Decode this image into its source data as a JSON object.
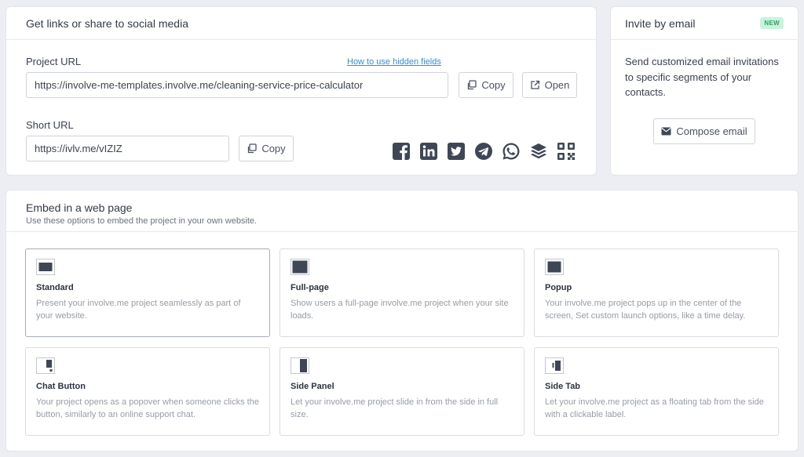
{
  "share": {
    "title": "Get links or share to social media",
    "project_url_label": "Project URL",
    "hidden_fields_link": "How to use hidden fields",
    "project_url_value": "https://involve-me-templates.involve.me/cleaning-service-price-calculator",
    "copy_label": "Copy",
    "open_label": "Open",
    "short_url_label": "Short URL",
    "short_url_value": "https://ivlv.me/vIZIZ",
    "social_icons": [
      "facebook-icon",
      "linkedin-icon",
      "twitter-icon",
      "telegram-icon",
      "whatsapp-icon",
      "buffer-icon",
      "qr-code-icon"
    ],
    "icon_color": "#3f4756"
  },
  "invite": {
    "title": "Invite by email",
    "badge": "NEW",
    "description": "Send customized email invitations to specific segments of your contacts.",
    "compose_label": "Compose email"
  },
  "embed": {
    "title": "Embed in a web page",
    "subtitle": "Use these options to embed the project in your own website.",
    "options": [
      {
        "icon": "standard-layout-icon",
        "title": "Standard",
        "description": "Present your involve.me project seamlessly as part of your website.",
        "selected": true
      },
      {
        "icon": "full-page-layout-icon",
        "title": "Full-page",
        "description": "Show users a full-page involve.me project when your site loads.",
        "selected": false
      },
      {
        "icon": "popup-layout-icon",
        "title": "Popup",
        "description": "Your involve.me project pops up in the center of the screen, Set custom launch options, like a time delay.",
        "selected": false
      },
      {
        "icon": "chat-button-layout-icon",
        "title": "Chat Button",
        "description": "Your project opens as a popover when someone clicks the button, similarly to an online support chat.",
        "selected": false
      },
      {
        "icon": "side-panel-layout-icon",
        "title": "Side Panel",
        "description": "Let your involve.me project slide in from the side in full size.",
        "selected": false
      },
      {
        "icon": "side-tab-layout-icon",
        "title": "Side Tab",
        "description": "Let your involve.me project as a floating tab from the side with a clickable label.",
        "selected": false
      }
    ]
  },
  "colors": {
    "background": "#eceef3",
    "card": "#ffffff",
    "link": "#2f8fd9",
    "badge_bg": "#c9f3dc",
    "badge_text": "#2f9e66",
    "icon_dark": "#3f4756"
  }
}
